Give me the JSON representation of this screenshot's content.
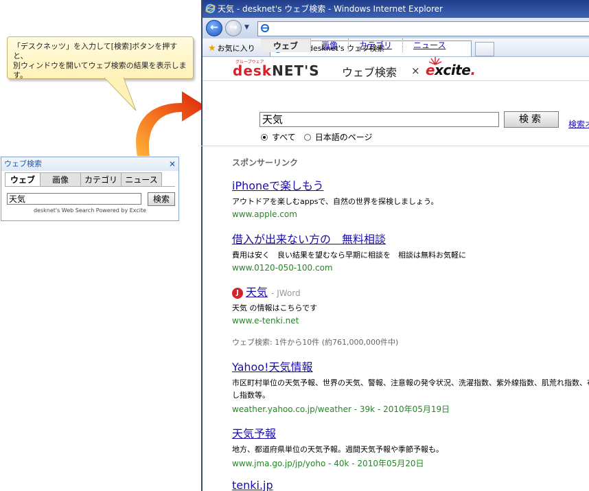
{
  "callout": {
    "line1": "「デスクネッツ」を入力して[検索]ボタンを押すと、",
    "line2": "別ウィンドウを開いてウェブ検索の結果を表示します。"
  },
  "widget": {
    "title": "ウェブ検索",
    "tabs": [
      "ウェブ",
      "画像",
      "カテゴリ",
      "ニュース"
    ],
    "query": "天気",
    "button": "検索",
    "footer": "desknet's Web Search Powered by Excite"
  },
  "ie": {
    "window_title": "天気 - desknet's ウェブ検索 - Windows Internet Explorer",
    "favorites_label": "お気に入り",
    "tab_title": "天気 - desknet's ウェブ検索"
  },
  "page": {
    "logo_brand_small": "グループウェア",
    "logo_brand_a": "desk",
    "logo_brand_b": "NET'S",
    "logo_title": "ウェブ検索",
    "logo_x": "×",
    "logo_partner_a": "e",
    "logo_partner_b": "xcite",
    "logo_partner_c": ".",
    "tabs": [
      "ウェブ",
      "画像",
      "カテゴリ",
      "ニュース"
    ],
    "query": "天気",
    "search_button": "検索",
    "options_link": "検索オプション",
    "radio_all": "すべて",
    "radio_japanese": "日本語のページ",
    "sponsor_heading": "スポンサーリンク",
    "sponsored": [
      {
        "title": "iPhoneで楽しもう",
        "desc": "アウトドアを楽しむappsで、自然の世界を探検しましょう。",
        "url": "www.apple.com"
      },
      {
        "title": "借入が出来ない方の　無料相談",
        "desc": "費用は安く　良い結果を望むなら早期に相談を　相談は無料お気軽に",
        "url": "www.0120-050-100.com"
      }
    ],
    "jword": {
      "badge": "J",
      "title": "天気",
      "source": "- JWord",
      "desc": "天気 の情報はこちらです",
      "url": "www.e-tenki.net"
    },
    "count_text": "ウェブ検索: 1件から10件 (約761,000,000件中)",
    "results": [
      {
        "title": "Yahoo!天気情報",
        "desc": "市区町村単位の天気予報、世界の天気、警報、注意報の発令状況、洗濯指数、紫外線指数、肌荒れ指数、布団干し指数等。",
        "url": "weather.yahoo.co.jp/weather - 39k - 2010年05月19日"
      },
      {
        "title": "天気予報",
        "desc": "地方、都道府県単位の天気予報。週間天気予報や季節予報も。",
        "url": "www.jma.go.jp/jp/yoho - 40k - 2010年05月20日"
      },
      {
        "title": "tenki.jp",
        "desc": "",
        "url": ""
      }
    ]
  }
}
